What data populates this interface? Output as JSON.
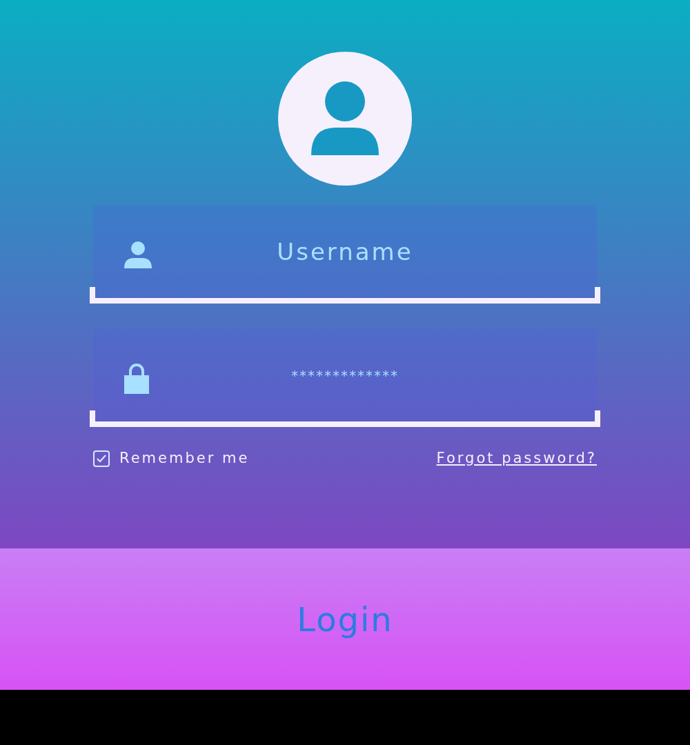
{
  "username": {
    "placeholder": "Username"
  },
  "password": {
    "value": "*************"
  },
  "remember": {
    "label": "Remember me",
    "checked": true
  },
  "forgot_link": "Forgot password?",
  "login_button": "Login"
}
